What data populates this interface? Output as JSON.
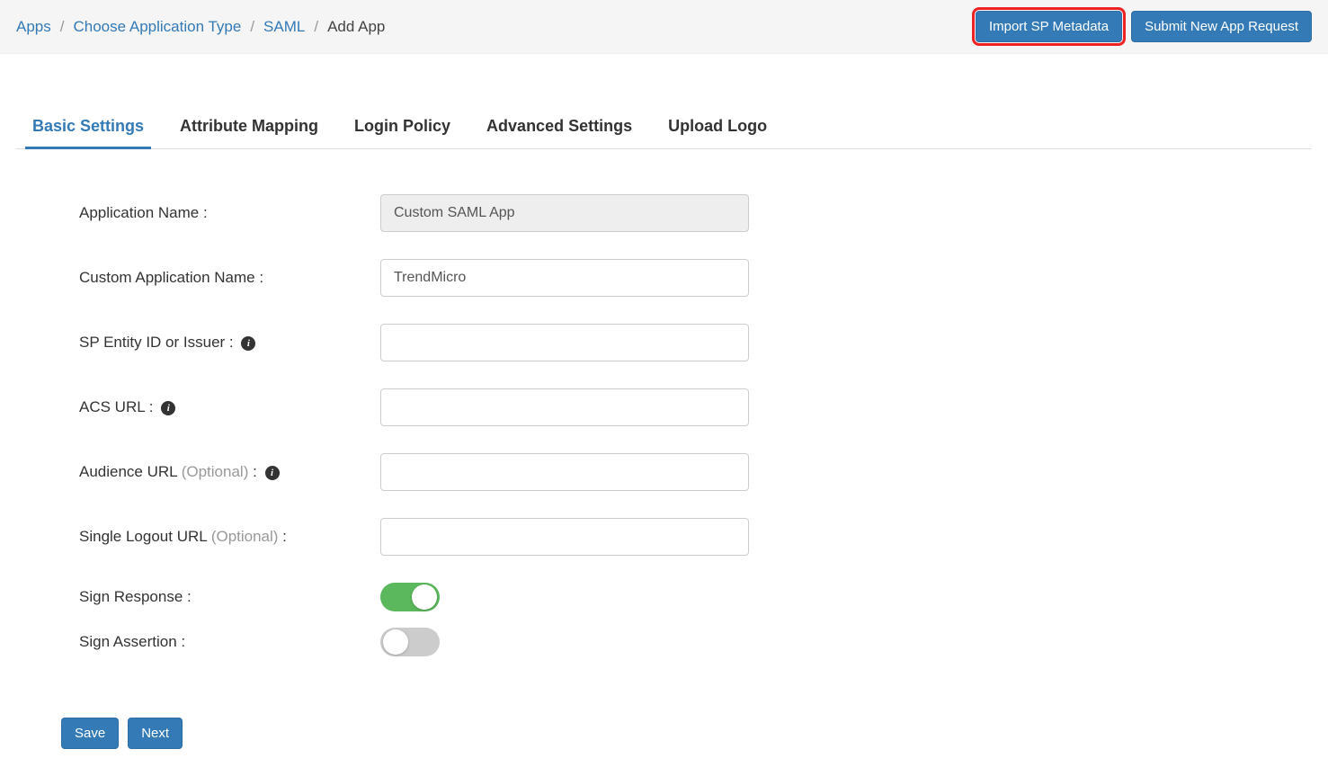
{
  "breadcrumb": {
    "items": [
      "Apps",
      "Choose Application Type",
      "SAML"
    ],
    "current": "Add App"
  },
  "topActions": {
    "import": "Import SP Metadata",
    "submit": "Submit New App Request"
  },
  "tabs": [
    "Basic Settings",
    "Attribute Mapping",
    "Login Policy",
    "Advanced Settings",
    "Upload Logo"
  ],
  "form": {
    "appName": {
      "label": "Application Name :",
      "value": "Custom SAML App"
    },
    "customAppName": {
      "label": "Custom Application Name :",
      "value": "TrendMicro"
    },
    "spEntityId": {
      "label": "SP Entity ID or Issuer :",
      "value": ""
    },
    "acsUrl": {
      "label": "ACS URL :",
      "value": ""
    },
    "audienceUrl": {
      "label": "Audience URL ",
      "optional": "(Optional)",
      "colon": " :",
      "value": ""
    },
    "sloUrl": {
      "label": "Single Logout URL ",
      "optional": "(Optional)",
      "colon": " :",
      "value": ""
    },
    "signResponse": {
      "label": "Sign Response :",
      "value": true
    },
    "signAssertion": {
      "label": "Sign Assertion :",
      "value": false
    }
  },
  "buttons": {
    "save": "Save",
    "next": "Next"
  }
}
